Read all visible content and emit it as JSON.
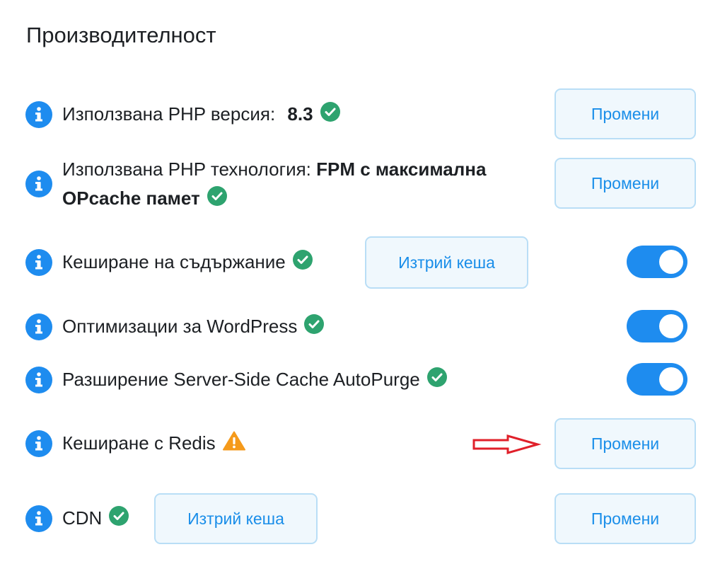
{
  "section": {
    "title": "Производителност"
  },
  "rows": {
    "php_version": {
      "label": "Използвана PHP версия:",
      "value": "8.3",
      "status": "check-circle-icon",
      "button": "Промени"
    },
    "php_technology": {
      "label": "Използвана PHP технология:",
      "value_line1": "FPM с максимална",
      "value_line2": "OPcache памет",
      "status": "check-circle-icon",
      "button": "Промени"
    },
    "content_cache": {
      "label": "Кеширане на съдържание",
      "status": "check-circle-icon",
      "clear_button": "Изтрий кеша",
      "enabled": true
    },
    "wordpress_opt": {
      "label": "Оптимизации за WordPress",
      "status": "check-circle-icon",
      "enabled": true
    },
    "autopurge": {
      "label": "Разширение Server-Side Cache AutoPurge",
      "status": "check-circle-icon",
      "enabled": true
    },
    "redis": {
      "label": "Кеширане с Redis",
      "status": "warning-triangle-icon",
      "button": "Промени"
    },
    "cdn": {
      "label": "CDN",
      "status": "check-circle-icon",
      "clear_button": "Изтрий кеша",
      "button": "Промени"
    }
  },
  "colors": {
    "accent": "#1e8cef",
    "success": "#2ea36f",
    "warning": "#f59a1b",
    "annotation": "#e0202a"
  }
}
